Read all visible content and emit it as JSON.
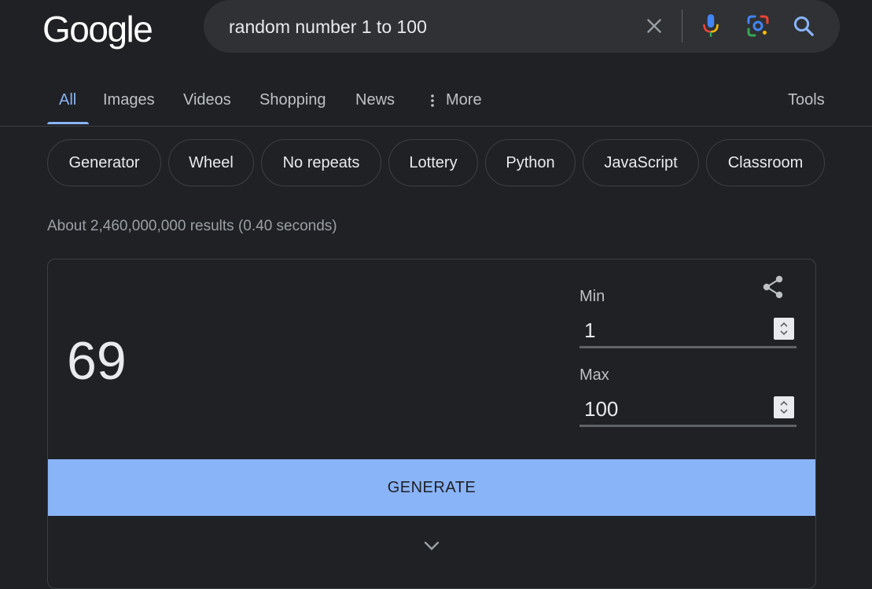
{
  "logo": "Google",
  "search": {
    "query": "random number 1 to 100",
    "icons": [
      "close-icon",
      "microphone-icon",
      "lens-camera-icon",
      "search-icon"
    ]
  },
  "tabs": {
    "items": [
      {
        "label": "All",
        "active": true
      },
      {
        "label": "Images"
      },
      {
        "label": "Videos"
      },
      {
        "label": "Shopping"
      },
      {
        "label": "News"
      },
      {
        "label": "More",
        "icon": "more-vert-icon"
      }
    ],
    "tools": "Tools"
  },
  "chips": [
    "Generator",
    "Wheel",
    "No repeats",
    "Lottery",
    "Python",
    "JavaScript",
    "Classroom"
  ],
  "stats": "About 2,460,000,000 results (0.40 seconds)",
  "rng": {
    "result": "69",
    "min_label": "Min",
    "min_value": "1",
    "max_label": "Max",
    "max_value": "100",
    "generate_label": "GENERATE"
  },
  "colors": {
    "background": "#202124",
    "accent": "#8ab4f8",
    "search_box": "#303134"
  }
}
